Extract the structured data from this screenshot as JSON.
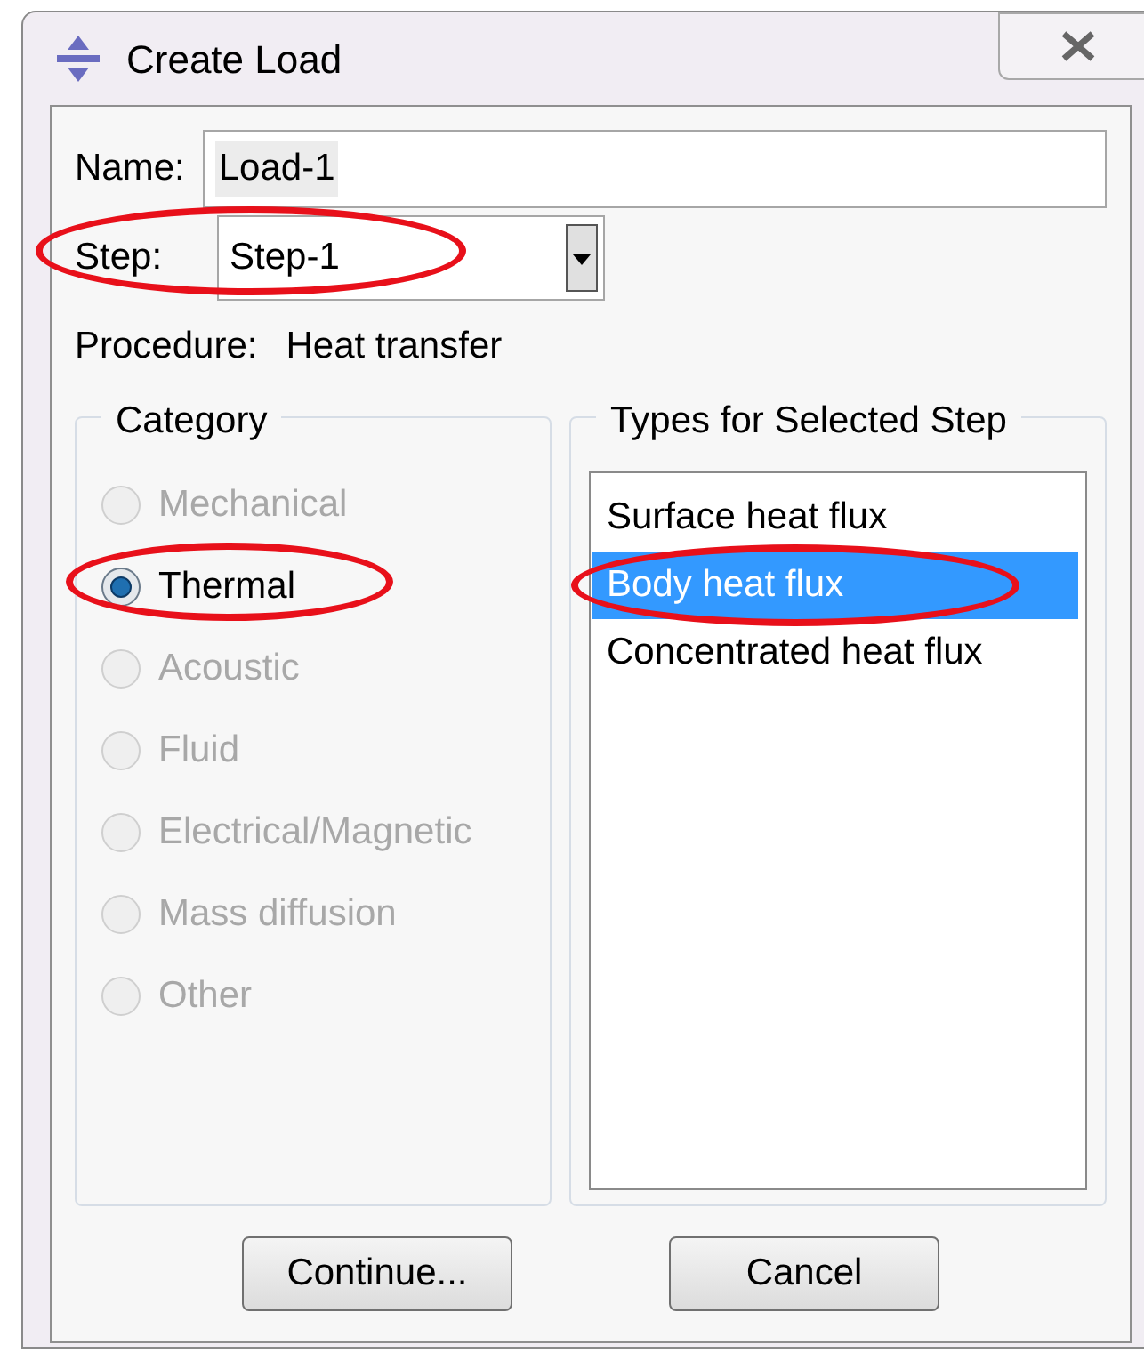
{
  "window": {
    "title": "Create Load"
  },
  "name": {
    "label": "Name:",
    "value": "Load-1"
  },
  "step": {
    "label": "Step:",
    "value": "Step-1",
    "highlighted": true
  },
  "procedure": {
    "label": "Procedure:",
    "value": "Heat transfer"
  },
  "category": {
    "title": "Category",
    "options": [
      {
        "label": "Mechanical",
        "selected": false,
        "disabled": true,
        "highlighted": false
      },
      {
        "label": "Thermal",
        "selected": true,
        "disabled": false,
        "highlighted": true
      },
      {
        "label": "Acoustic",
        "selected": false,
        "disabled": true,
        "highlighted": false
      },
      {
        "label": "Fluid",
        "selected": false,
        "disabled": true,
        "highlighted": false
      },
      {
        "label": "Electrical/Magnetic",
        "selected": false,
        "disabled": true,
        "highlighted": false
      },
      {
        "label": "Mass diffusion",
        "selected": false,
        "disabled": true,
        "highlighted": false
      },
      {
        "label": "Other",
        "selected": false,
        "disabled": true,
        "highlighted": false
      }
    ]
  },
  "types": {
    "title": "Types for Selected Step",
    "items": [
      {
        "label": "Surface heat flux",
        "selected": false,
        "highlighted": false
      },
      {
        "label": "Body heat flux",
        "selected": true,
        "highlighted": true
      },
      {
        "label": "Concentrated heat flux",
        "selected": false,
        "highlighted": false
      }
    ]
  },
  "buttons": [
    "Continue...",
    "Cancel"
  ]
}
